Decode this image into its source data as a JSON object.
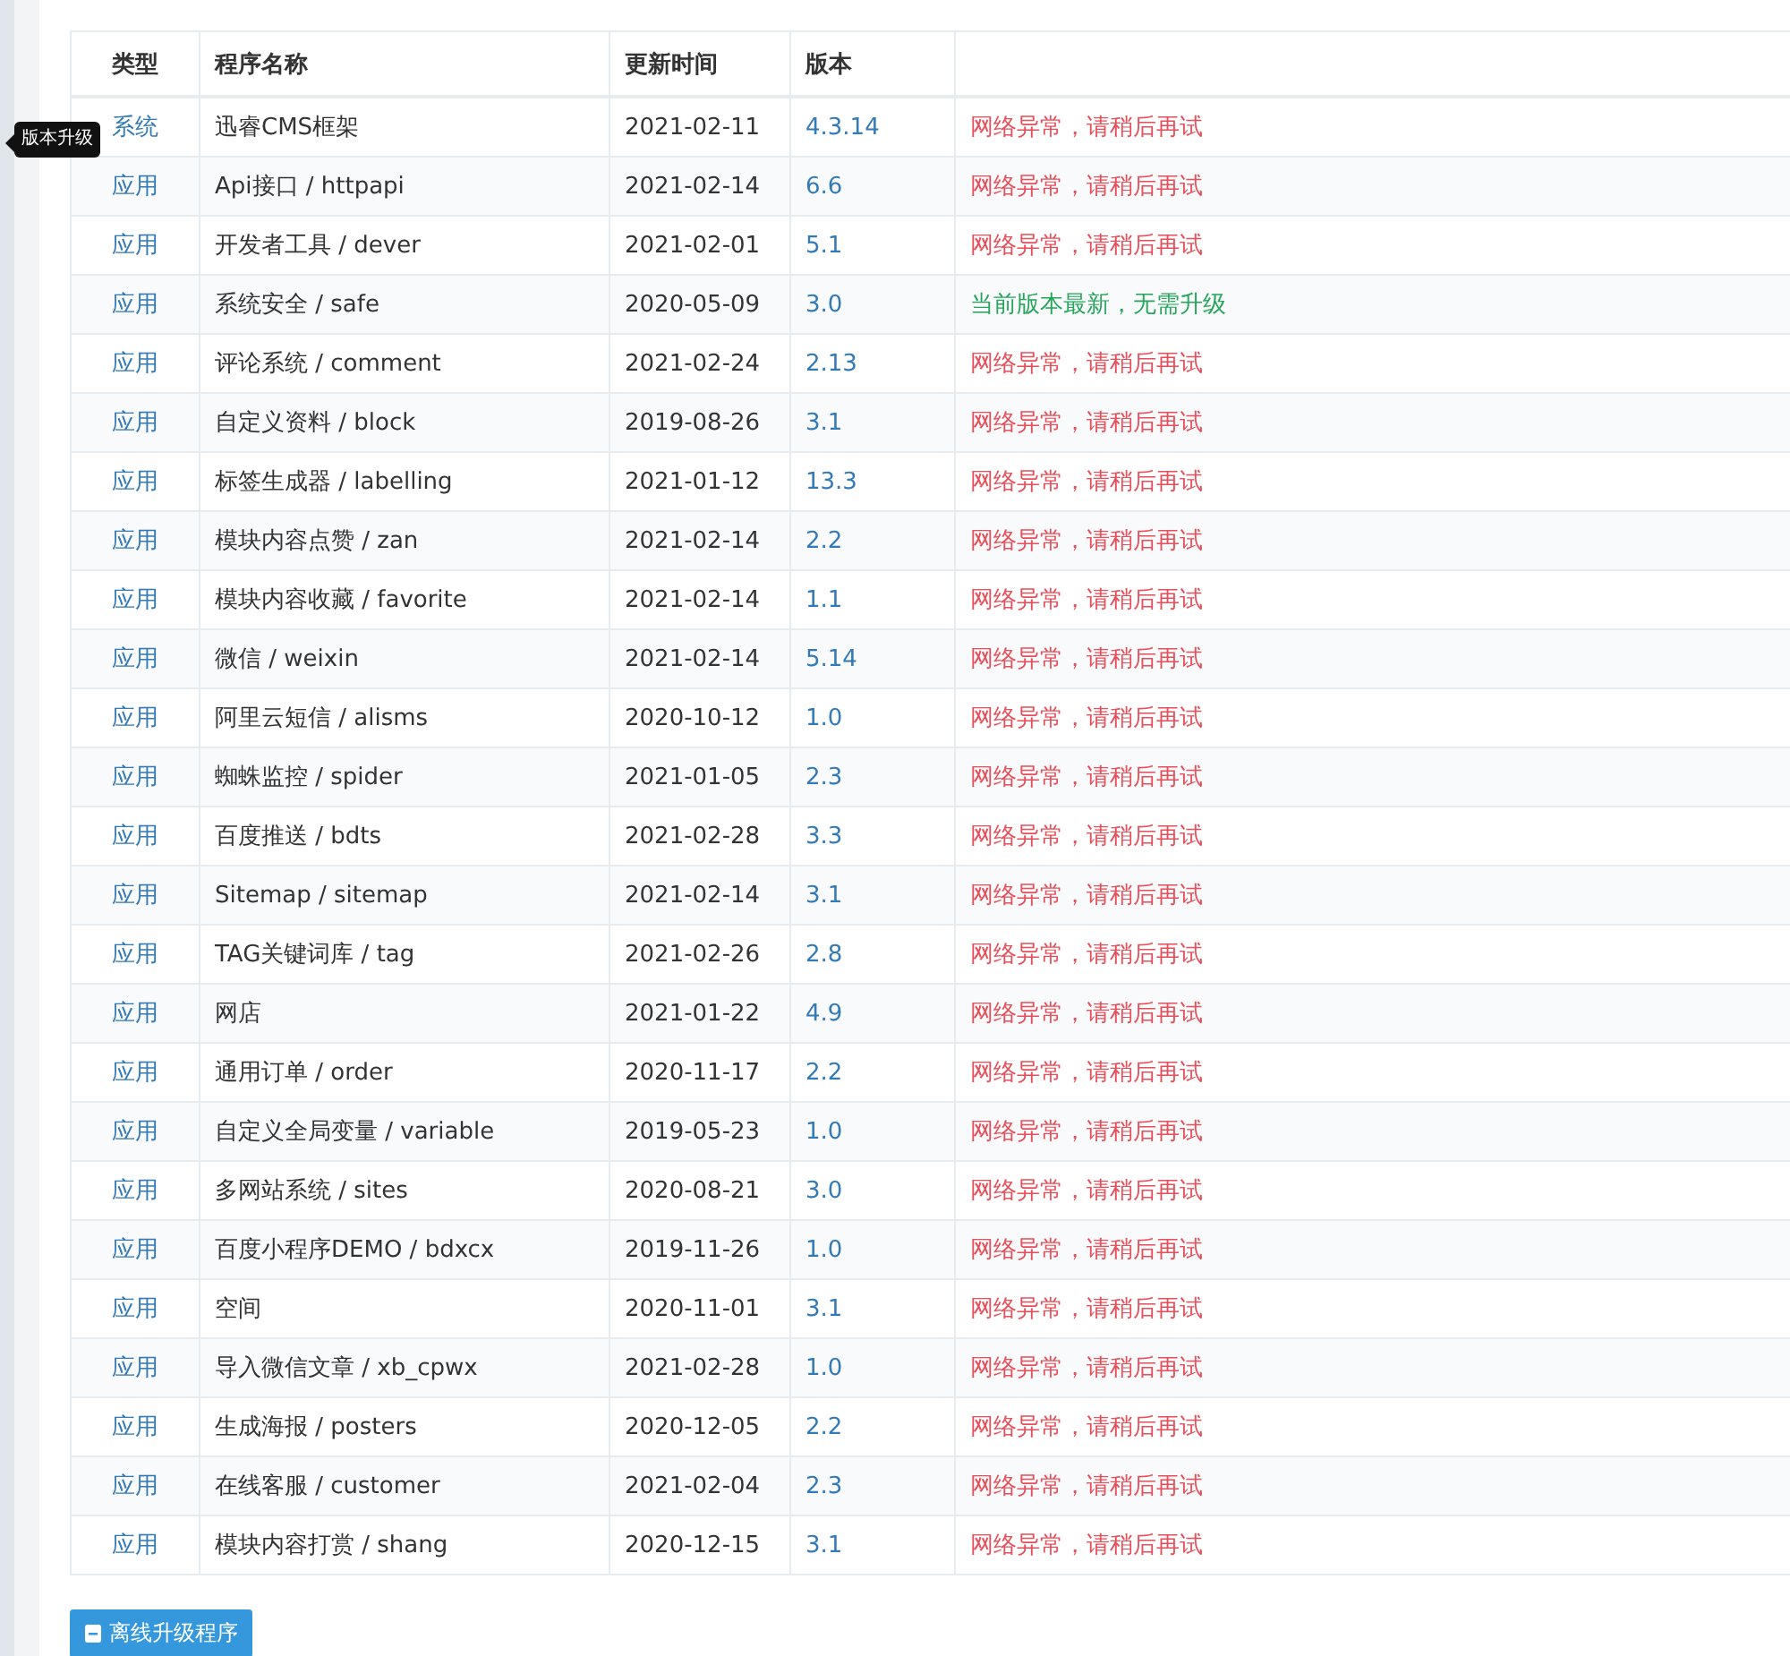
{
  "tooltip": {
    "text": "版本升级"
  },
  "table": {
    "columns": [
      "类型",
      "程序名称",
      "更新时间",
      "版本"
    ],
    "rows": [
      {
        "type": "系统",
        "name": "迅睿CMS框架",
        "date": "2021-02-11",
        "version": "4.3.14",
        "status": "网络异常，请稍后再试",
        "kind": "error"
      },
      {
        "type": "应用",
        "name": "Api接口 / httpapi",
        "date": "2021-02-14",
        "version": "6.6",
        "status": "网络异常，请稍后再试",
        "kind": "error"
      },
      {
        "type": "应用",
        "name": "开发者工具 / dever",
        "date": "2021-02-01",
        "version": "5.1",
        "status": "网络异常，请稍后再试",
        "kind": "error"
      },
      {
        "type": "应用",
        "name": "系统安全 / safe",
        "date": "2020-05-09",
        "version": "3.0",
        "status": "当前版本最新，无需升级",
        "kind": "ok"
      },
      {
        "type": "应用",
        "name": "评论系统 / comment",
        "date": "2021-02-24",
        "version": "2.13",
        "status": "网络异常，请稍后再试",
        "kind": "error"
      },
      {
        "type": "应用",
        "name": "自定义资料 / block",
        "date": "2019-08-26",
        "version": "3.1",
        "status": "网络异常，请稍后再试",
        "kind": "error"
      },
      {
        "type": "应用",
        "name": "标签生成器 / labelling",
        "date": "2021-01-12",
        "version": "13.3",
        "status": "网络异常，请稍后再试",
        "kind": "error"
      },
      {
        "type": "应用",
        "name": "模块内容点赞 / zan",
        "date": "2021-02-14",
        "version": "2.2",
        "status": "网络异常，请稍后再试",
        "kind": "error"
      },
      {
        "type": "应用",
        "name": "模块内容收藏 / favorite",
        "date": "2021-02-14",
        "version": "1.1",
        "status": "网络异常，请稍后再试",
        "kind": "error"
      },
      {
        "type": "应用",
        "name": "微信 / weixin",
        "date": "2021-02-14",
        "version": "5.14",
        "status": "网络异常，请稍后再试",
        "kind": "error"
      },
      {
        "type": "应用",
        "name": "阿里云短信 / alisms",
        "date": "2020-10-12",
        "version": "1.0",
        "status": "网络异常，请稍后再试",
        "kind": "error"
      },
      {
        "type": "应用",
        "name": "蜘蛛监控 / spider",
        "date": "2021-01-05",
        "version": "2.3",
        "status": "网络异常，请稍后再试",
        "kind": "error"
      },
      {
        "type": "应用",
        "name": "百度推送 / bdts",
        "date": "2021-02-28",
        "version": "3.3",
        "status": "网络异常，请稍后再试",
        "kind": "error"
      },
      {
        "type": "应用",
        "name": "Sitemap / sitemap",
        "date": "2021-02-14",
        "version": "3.1",
        "status": "网络异常，请稍后再试",
        "kind": "error"
      },
      {
        "type": "应用",
        "name": "TAG关键词库 / tag",
        "date": "2021-02-26",
        "version": "2.8",
        "status": "网络异常，请稍后再试",
        "kind": "error"
      },
      {
        "type": "应用",
        "name": "网店",
        "date": "2021-01-22",
        "version": "4.9",
        "status": "网络异常，请稍后再试",
        "kind": "error"
      },
      {
        "type": "应用",
        "name": "通用订单 / order",
        "date": "2020-11-17",
        "version": "2.2",
        "status": "网络异常，请稍后再试",
        "kind": "error"
      },
      {
        "type": "应用",
        "name": "自定义全局变量 / variable",
        "date": "2019-05-23",
        "version": "1.0",
        "status": "网络异常，请稍后再试",
        "kind": "error"
      },
      {
        "type": "应用",
        "name": "多网站系统 / sites",
        "date": "2020-08-21",
        "version": "3.0",
        "status": "网络异常，请稍后再试",
        "kind": "error"
      },
      {
        "type": "应用",
        "name": "百度小程序DEMO / bdxcx",
        "date": "2019-11-26",
        "version": "1.0",
        "status": "网络异常，请稍后再试",
        "kind": "error"
      },
      {
        "type": "应用",
        "name": "空间",
        "date": "2020-11-01",
        "version": "3.1",
        "status": "网络异常，请稍后再试",
        "kind": "error"
      },
      {
        "type": "应用",
        "name": "导入微信文章 / xb_cpwx",
        "date": "2021-02-28",
        "version": "1.0",
        "status": "网络异常，请稍后再试",
        "kind": "error"
      },
      {
        "type": "应用",
        "name": "生成海报 / posters",
        "date": "2020-12-05",
        "version": "2.2",
        "status": "网络异常，请稍后再试",
        "kind": "error"
      },
      {
        "type": "应用",
        "name": "在线客服 / customer",
        "date": "2021-02-04",
        "version": "2.3",
        "status": "网络异常，请稍后再试",
        "kind": "error"
      },
      {
        "type": "应用",
        "name": "模块内容打赏 / shang",
        "date": "2020-12-15",
        "version": "3.1",
        "status": "网络异常，请稍后再试",
        "kind": "error"
      }
    ]
  },
  "button": {
    "label": "离线升级程序"
  }
}
